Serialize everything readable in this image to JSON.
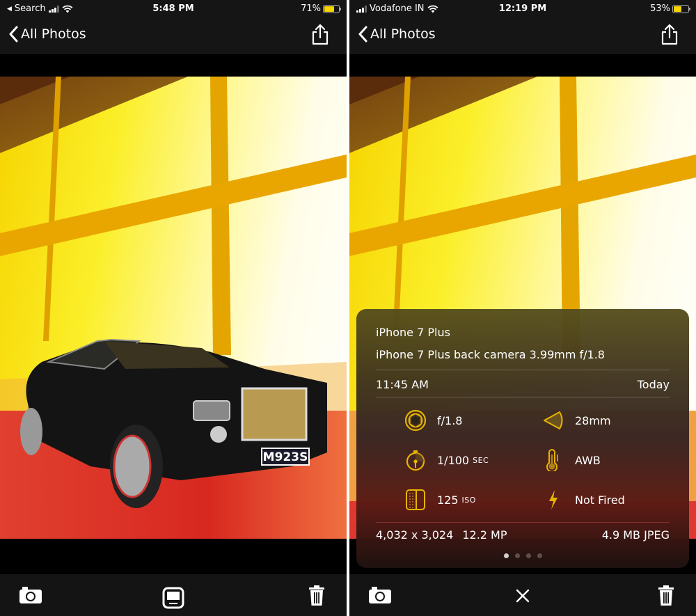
{
  "left_screen": {
    "status_bar": {
      "back_app": "Search",
      "time": "5:48 PM",
      "battery_percent_text": "71%",
      "battery_level": 0.71
    },
    "nav": {
      "back_label": "All Photos",
      "share_icon": "share-icon"
    },
    "photo": {
      "subject": "toy car",
      "license_plate": "M923S"
    },
    "toolbar": {
      "left_icon": "camera-icon",
      "center_icon": "info-panel-toggle-icon",
      "right_icon": "trash-icon"
    }
  },
  "right_screen": {
    "status_bar": {
      "carrier": "Vodafone IN",
      "time": "12:19 PM",
      "battery_percent_text": "53%",
      "battery_level": 0.53
    },
    "nav": {
      "back_label": "All Photos",
      "share_icon": "share-icon"
    },
    "info_panel": {
      "device": "iPhone 7 Plus",
      "lens": "iPhone 7 Plus back camera 3.99mm f/1.8",
      "time": "11:45 AM",
      "date": "Today",
      "specs": [
        {
          "icon": "aperture-icon",
          "value": "f/1.8",
          "unit": ""
        },
        {
          "icon": "focal-length-icon",
          "value": "28mm",
          "unit": ""
        },
        {
          "icon": "shutter-timer-icon",
          "value": "1/100",
          "unit": "SEC"
        },
        {
          "icon": "thermometer-icon",
          "value": "AWB",
          "unit": ""
        },
        {
          "icon": "iso-sensor-icon",
          "value": "125",
          "unit": "ISO"
        },
        {
          "icon": "flash-icon",
          "value": "Not Fired",
          "unit": ""
        }
      ],
      "resolution": "4,032 x 3,024",
      "megapixels": "12.2 MP",
      "file_info": "4.9 MB JPEG",
      "page_count": 4,
      "active_page": 1
    },
    "toolbar": {
      "left_icon": "camera-icon",
      "center_icon": "close-icon",
      "right_icon": "trash-icon"
    }
  },
  "colors": {
    "accent_icon": "#e8b400",
    "bar_background": "#151515",
    "battery_fill": "#f5d400"
  }
}
